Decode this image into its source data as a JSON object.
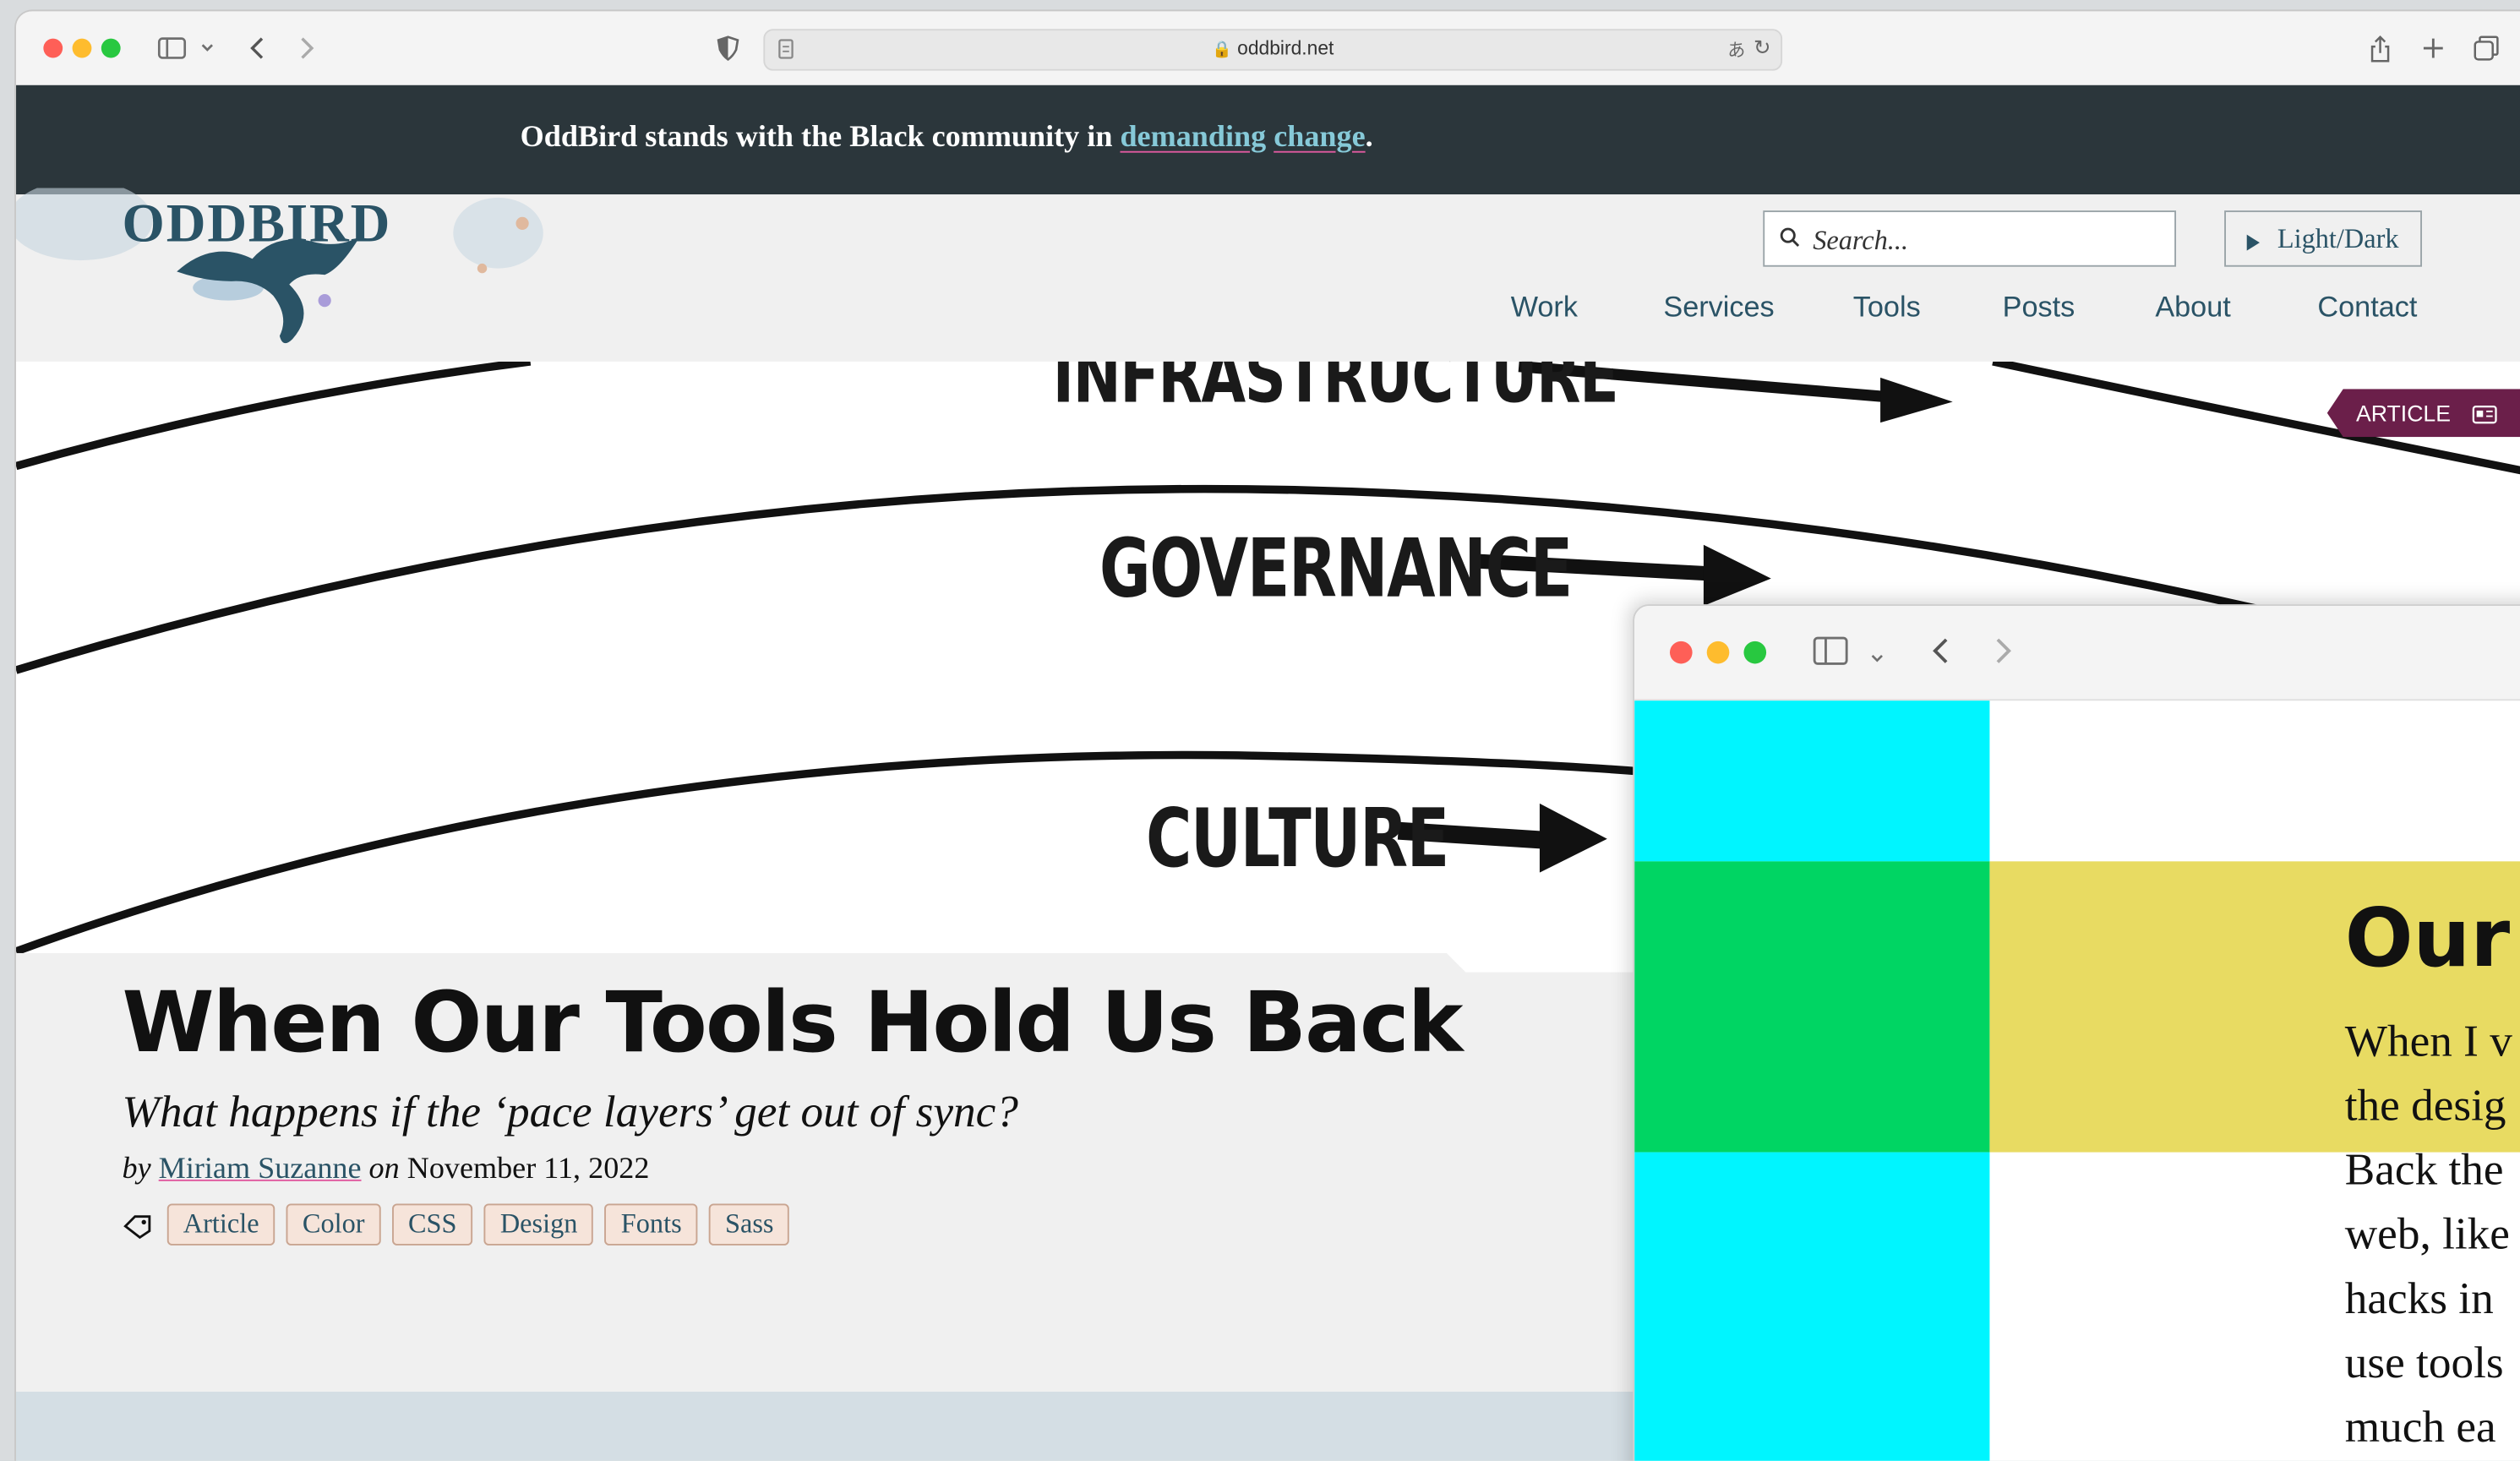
{
  "browser": {
    "url": "oddbird.net"
  },
  "banner": {
    "text_before": "OddBird stands with the Black community in ",
    "link1": "demanding",
    "link2": "change",
    "text_after": "."
  },
  "site": {
    "logo": "ODDBIRD",
    "search_placeholder": "Search...",
    "theme_toggle": "Light/Dark",
    "nav": [
      "Work",
      "Services",
      "Tools",
      "Posts",
      "About",
      "Contact"
    ]
  },
  "hero": {
    "labels": {
      "infrastructure": "INFRASTRUCTURE",
      "governance": "GOVERNANCE",
      "culture": "CULTURE"
    },
    "badge": "ARTICLE"
  },
  "article": {
    "title": "When Our Tools Hold Us Back",
    "subtitle": "What happens if the ‘pace layers’ get out of sync?",
    "by": "by",
    "author": "Miriam Suzanne",
    "on": "on",
    "date": "November 11, 2022",
    "tags": [
      "Article",
      "Color",
      "CSS",
      "Design",
      "Fonts",
      "Sass"
    ]
  },
  "overlay_window": {
    "heading": "Our v",
    "lines": [
      "When I v",
      "the desig",
      "Back the",
      "web, like",
      "hacks in",
      "use tools",
      "much ea"
    ]
  },
  "colors": {
    "banner_bg": "#2b363b",
    "brand": "#2a5366",
    "badge": "#6b1f4a",
    "cyan": "#00f5ff",
    "green": "#00d563",
    "yellow": "#e8db62"
  }
}
